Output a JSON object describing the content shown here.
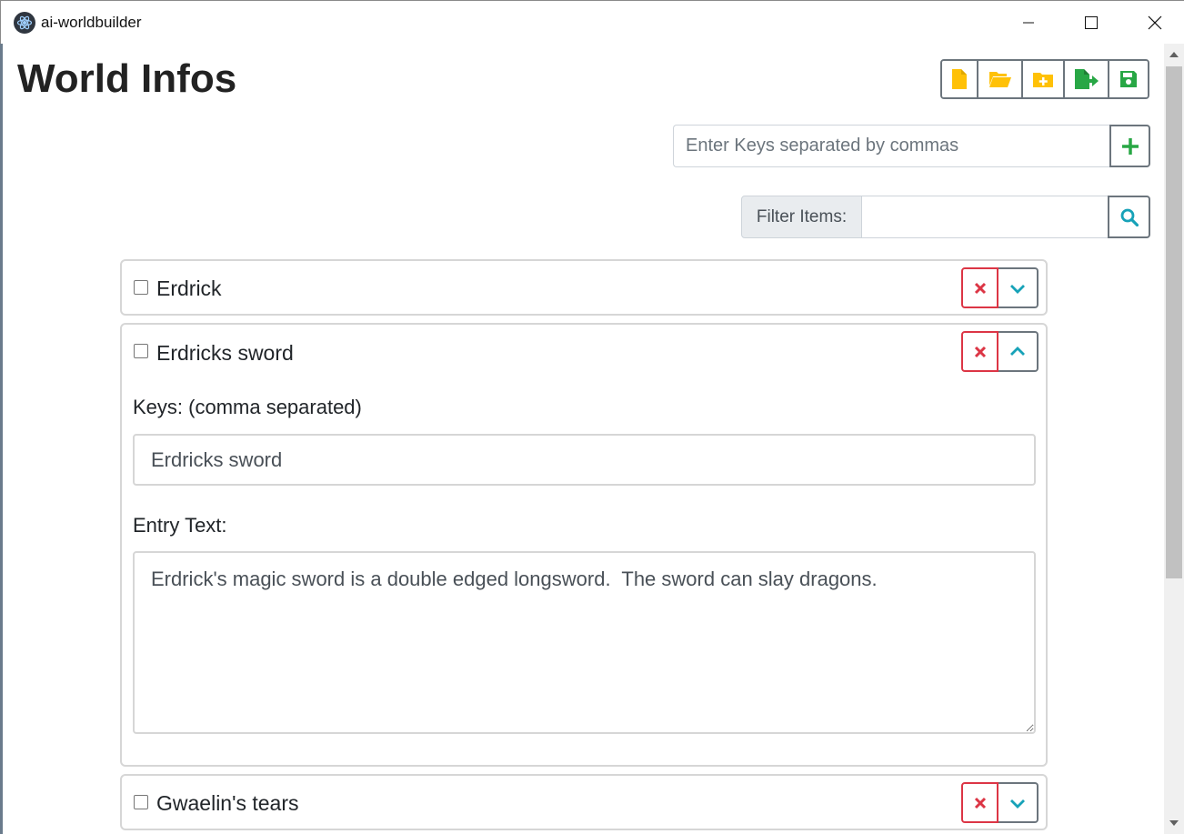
{
  "window": {
    "app_title": "ai-worldbuilder",
    "controls": {
      "minimize": "minimize-icon",
      "maximize": "maximize-icon",
      "close": "close-icon"
    }
  },
  "page": {
    "title": "World Infos"
  },
  "toolbar": {
    "buttons": [
      {
        "name": "new-file",
        "icon": "file-icon",
        "color": "#ffc107"
      },
      {
        "name": "open-folder",
        "icon": "folder-open-icon",
        "color": "#ffc107"
      },
      {
        "name": "add-folder",
        "icon": "folder-plus-icon",
        "color": "#ffc107"
      },
      {
        "name": "export",
        "icon": "file-export-icon",
        "color": "#28a745"
      },
      {
        "name": "save",
        "icon": "save-icon",
        "color": "#28a745"
      }
    ]
  },
  "add_entry": {
    "placeholder": "Enter Keys separated by commas",
    "button_icon": "plus-icon"
  },
  "filter": {
    "label": "Filter Items:",
    "value": "",
    "button_icon": "search-icon"
  },
  "entries": [
    {
      "title": "Erdrick",
      "expanded": false,
      "checked": false
    },
    {
      "title": "Erdricks sword",
      "expanded": true,
      "checked": false,
      "keys_label": "Keys: (comma separated)",
      "keys_value": "Erdricks sword",
      "text_label": "Entry Text:",
      "text_value": "Erdrick's magic sword is a double edged longsword.  The sword can slay dragons."
    },
    {
      "title": "Gwaelin's tears",
      "expanded": false,
      "checked": false
    }
  ],
  "colors": {
    "warning": "#ffc107",
    "success": "#28a745",
    "danger": "#dc3545",
    "info": "#17a2b8",
    "secondary": "#6c757d"
  }
}
